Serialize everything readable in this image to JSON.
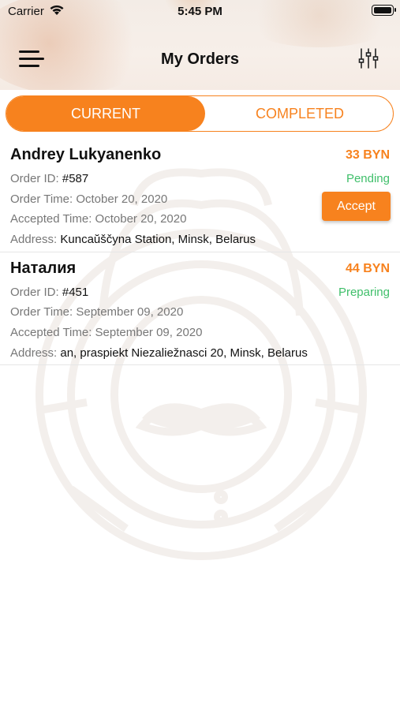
{
  "status_bar": {
    "carrier": "Carrier",
    "time": "5:45 PM"
  },
  "header": {
    "title": "My Orders",
    "menu_icon": "hamburger-menu-icon",
    "filter_icon": "sliders-icon"
  },
  "tabs": [
    {
      "label": "CURRENT",
      "active": true
    },
    {
      "label": "COMPLETED",
      "active": false
    }
  ],
  "colors": {
    "accent": "#f7821e",
    "status_green": "#3fbf6a",
    "label_gray": "#777777"
  },
  "orders": [
    {
      "customer": "Andrey Lukyanenko",
      "price": "33 BYN",
      "status": "Pending",
      "order_id_label": "Order ID:",
      "order_id": "#587",
      "order_time": "Order Time: October 20, 2020",
      "accepted_time": "Accepted Time: October 20, 2020",
      "address_label": "Address:",
      "address": "Kuncaŭščyna Station, Minsk, Belarus",
      "action_label": "Accept"
    },
    {
      "customer": "Наталия",
      "price": "44 BYN",
      "status": "Preparing",
      "order_id_label": "Order ID:",
      "order_id": "#451",
      "order_time": "Order Time: September 09, 2020",
      "accepted_time": "Accepted Time: September 09, 2020",
      "address_label": "Address:",
      "address": "an, praspiekt Niezaliežnasci 20, Minsk, Belarus"
    }
  ]
}
